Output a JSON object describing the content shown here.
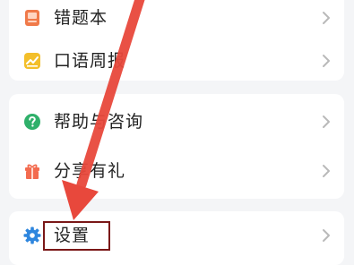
{
  "menu_top": [
    {
      "label": "错题本",
      "icon": "notebook-icon",
      "icon_color": "#f07a4a"
    },
    {
      "label": "口语周报",
      "icon": "trend-chart-icon",
      "icon_color": "#f3bf2a"
    }
  ],
  "menu_mid": [
    {
      "label": "帮助与咨询",
      "icon": "question-circle-icon",
      "icon_color": "#2fb06a"
    },
    {
      "label": "分享有礼",
      "icon": "gift-icon",
      "icon_color": "#f36b4f"
    }
  ],
  "menu_bottom": [
    {
      "label": "设置",
      "icon": "gear-icon",
      "icon_color": "#2e86de"
    }
  ],
  "chevron_icon": "chevron-right-icon",
  "annotation": {
    "arrow_color": "#e8483c",
    "highlight_color": "#7a1717"
  }
}
